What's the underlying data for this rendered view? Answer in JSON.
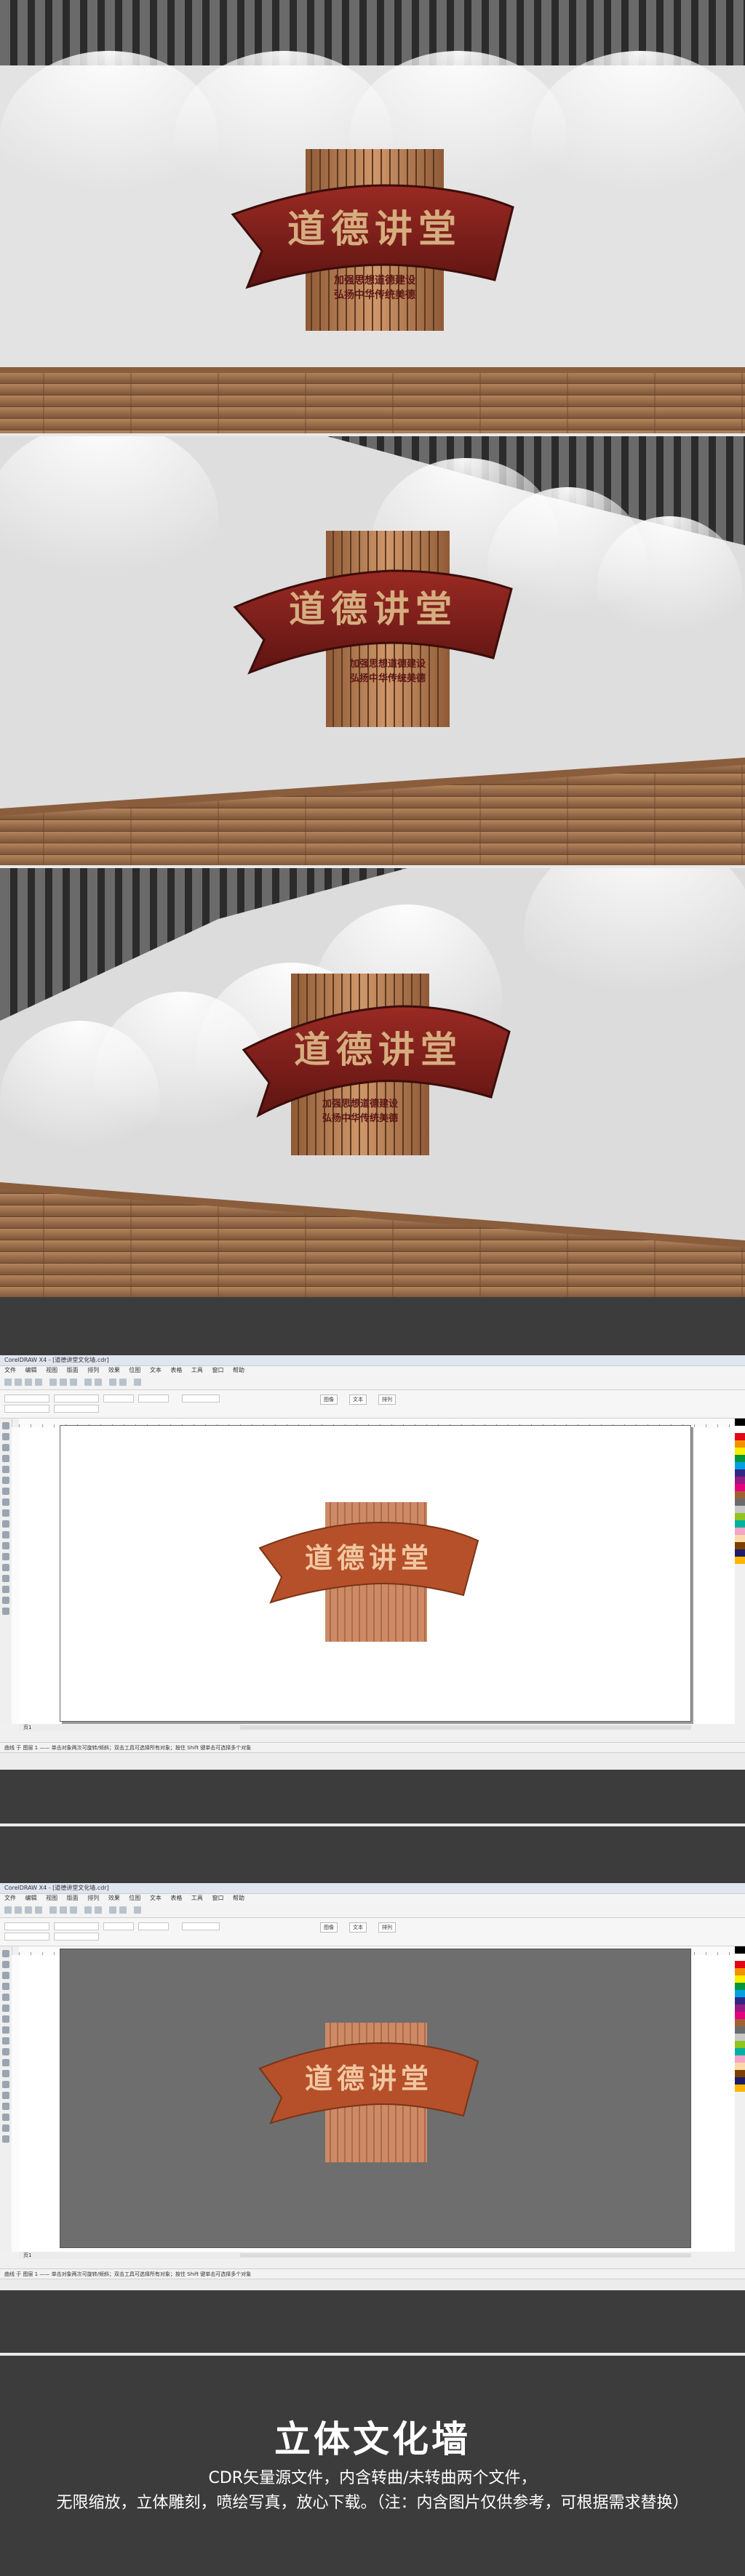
{
  "sign": {
    "title": "道德讲堂",
    "subtitle_line1": "加强思想道德建设",
    "subtitle_line2": "弘扬中华传统美德"
  },
  "editor1": {
    "title": "CorelDRAW X4 - [道德讲堂文化墙.cdr]",
    "menu": [
      "文件",
      "编辑",
      "视图",
      "版面",
      "排列",
      "效果",
      "位图",
      "文本",
      "表格",
      "工具",
      "窗口",
      "帮助"
    ],
    "tabs": [
      "图像",
      "文本",
      "排列"
    ],
    "page_tab": "页1",
    "status": "曲线 于 图层 1 —— 单击对象两次可旋转/倾斜；双击工具可选择所有对象；按住 Shift 键单击可选择多个对象"
  },
  "editor2": {
    "title": "CorelDRAW X4 - [道德讲堂文化墙.cdr]",
    "menu": [
      "文件",
      "编辑",
      "视图",
      "版面",
      "排列",
      "效果",
      "位图",
      "文本",
      "表格",
      "工具",
      "窗口",
      "帮助"
    ],
    "tabs": [
      "图像",
      "文本",
      "排列"
    ],
    "page_tab": "页1",
    "status": "曲线 于 图层 1 —— 单击对象两次可旋转/倾斜；双击工具可选择所有对象；按住 Shift 键单击可选择多个对象"
  },
  "footer": {
    "title": "立体文化墙",
    "line1": "CDR矢量源文件，内含转曲/未转曲两个文件，",
    "line2": "无限缩放，立体雕刻，喷绘写真，放心下载。（注：内含图片仅供参考，可根据需求替换）"
  },
  "colors": {
    "banner_red": "#7e1d1a",
    "wood": "#b97f55",
    "text_gold": "#d6ad7f",
    "editor_banner": "#b5502a",
    "background": "#3c3c3c"
  },
  "palette": [
    "#000000",
    "#ffffff",
    "#e30613",
    "#f39200",
    "#ffed00",
    "#009640",
    "#00a0e3",
    "#312783",
    "#951b81",
    "#e6007e",
    "#a06030",
    "#6b6b6b",
    "#c8c8c8",
    "#8fc31f",
    "#00b0a0",
    "#f5a3c7",
    "#fcd8a8",
    "#7b3f00",
    "#1d1d6b",
    "#ffb400"
  ]
}
